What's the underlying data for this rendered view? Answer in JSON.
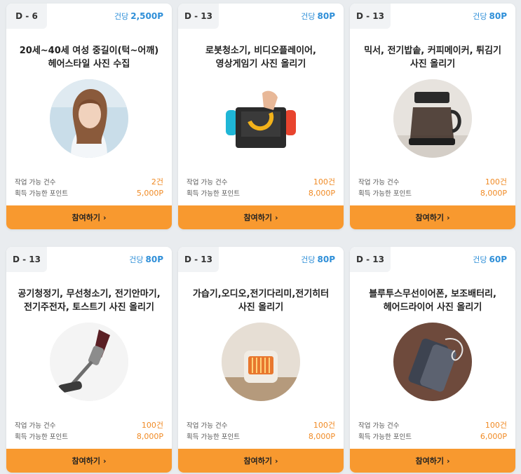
{
  "labels": {
    "per_item": "건당",
    "available": "작업 가능 건수",
    "points": "획득 가능한 포인트",
    "join": "참여하기",
    "join_chevron": "›"
  },
  "cards": [
    {
      "dday": "D - 6",
      "per_point": "2,500P",
      "title": [
        "20세~40세 여성 중길이(턱~어깨)",
        "헤어스타일 사진 수집"
      ],
      "count": "2건",
      "total": "5,000P",
      "image": "woman-portrait"
    },
    {
      "dday": "D - 13",
      "per_point": "80P",
      "title": [
        "로봇청소기, 비디오플레이어,",
        "영상게임기 사진 올리기"
      ],
      "count": "100건",
      "total": "8,000P",
      "image": "game-console"
    },
    {
      "dday": "D - 13",
      "per_point": "80P",
      "title": [
        "믹서, 전기밥솥, 커피메이커, 튀김기",
        "사진 올리기"
      ],
      "count": "100건",
      "total": "8,000P",
      "image": "coffee-maker"
    },
    {
      "dday": "D - 13",
      "per_point": "80P",
      "title": [
        "공기청정기, 무선청소기, 전기안마기,",
        "전기주전자, 토스트기 사진 올리기"
      ],
      "count": "100건",
      "total": "8,000P",
      "image": "cordless-vacuum"
    },
    {
      "dday": "D - 13",
      "per_point": "80P",
      "title": [
        "가습기,오디오,전기다리미,전기히터",
        "사진 올리기"
      ],
      "count": "100건",
      "total": "8,000P",
      "image": "electric-heater"
    },
    {
      "dday": "D - 13",
      "per_point": "60P",
      "title": [
        "블루투스무선이어폰, 보조배터리,",
        "헤어드라이어 사진 올리기"
      ],
      "count": "100건",
      "total": "6,000P",
      "image": "power-bank"
    }
  ]
}
